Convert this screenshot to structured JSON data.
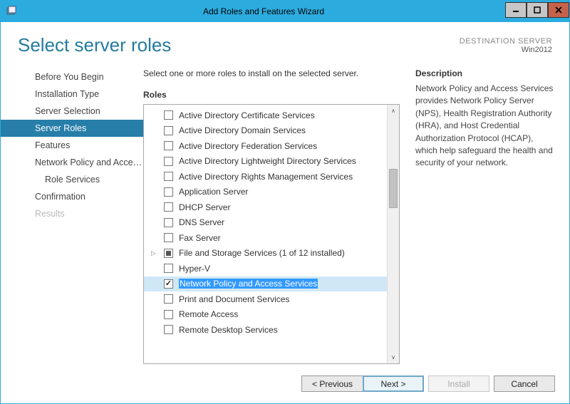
{
  "window": {
    "title": "Add Roles and Features Wizard"
  },
  "header": {
    "page_title": "Select server roles",
    "destination_label": "DESTINATION SERVER",
    "destination_value": "Win2012"
  },
  "nav": {
    "items": [
      {
        "label": "Before You Begin",
        "state": "normal"
      },
      {
        "label": "Installation Type",
        "state": "normal"
      },
      {
        "label": "Server Selection",
        "state": "normal"
      },
      {
        "label": "Server Roles",
        "state": "selected"
      },
      {
        "label": "Features",
        "state": "normal"
      },
      {
        "label": "Network Policy and Acces...",
        "state": "normal"
      },
      {
        "label": "Role Services",
        "state": "sub"
      },
      {
        "label": "Confirmation",
        "state": "normal"
      },
      {
        "label": "Results",
        "state": "disabled"
      }
    ]
  },
  "main": {
    "instruction": "Select one or more roles to install on the selected server.",
    "roles_label": "Roles",
    "roles": [
      {
        "label": "Active Directory Certificate Services",
        "checked": false
      },
      {
        "label": "Active Directory Domain Services",
        "checked": false
      },
      {
        "label": "Active Directory Federation Services",
        "checked": false
      },
      {
        "label": "Active Directory Lightweight Directory Services",
        "checked": false
      },
      {
        "label": "Active Directory Rights Management Services",
        "checked": false
      },
      {
        "label": "Application Server",
        "checked": false
      },
      {
        "label": "DHCP Server",
        "checked": false
      },
      {
        "label": "DNS Server",
        "checked": false
      },
      {
        "label": "Fax Server",
        "checked": false
      },
      {
        "label": "File and Storage Services (1 of 12 installed)",
        "checked": "mixed",
        "expandable": true
      },
      {
        "label": "Hyper-V",
        "checked": false
      },
      {
        "label": "Network Policy and Access Services",
        "checked": true,
        "selected": true
      },
      {
        "label": "Print and Document Services",
        "checked": false
      },
      {
        "label": "Remote Access",
        "checked": false
      },
      {
        "label": "Remote Desktop Services",
        "checked": false
      }
    ],
    "description_label": "Description",
    "description_text": "Network Policy and Access Services provides Network Policy Server (NPS), Health Registration Authority (HRA), and Host Credential Authorization Protocol (HCAP), which help safeguard the health and security of your network."
  },
  "footer": {
    "previous": "< Previous",
    "next": "Next >",
    "install": "Install",
    "cancel": "Cancel"
  }
}
